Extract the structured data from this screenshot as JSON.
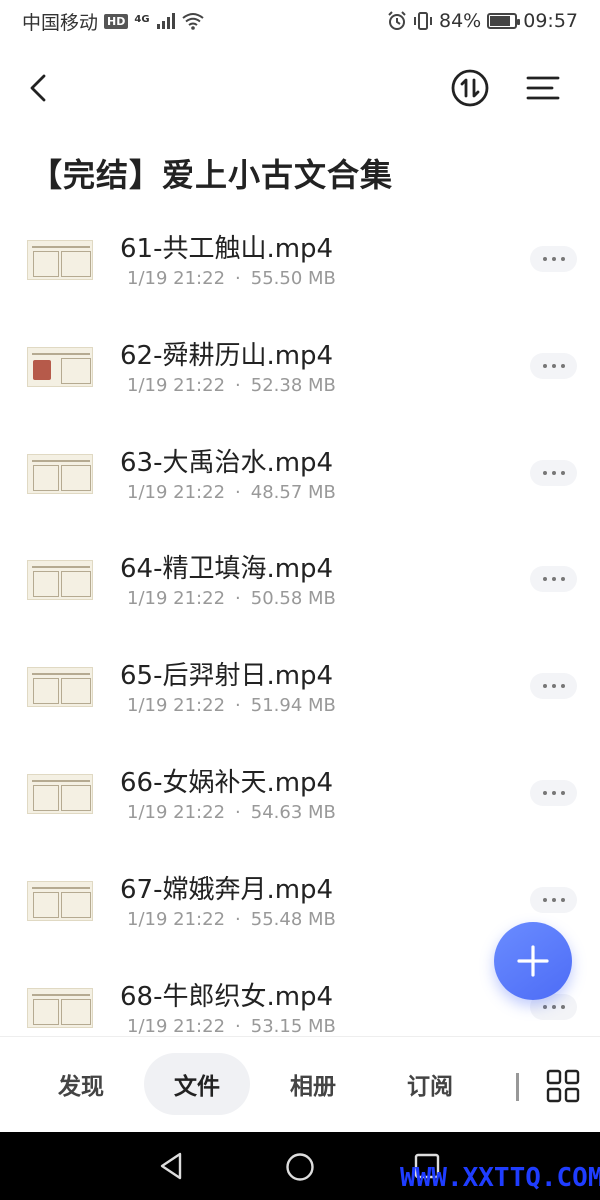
{
  "status_bar": {
    "carrier": "中国移动",
    "hd": "HD",
    "network": "4G",
    "battery_percent": "84%",
    "battery_level": 0.84,
    "time": "09:57"
  },
  "header": {
    "back_icon": "chevron-left-icon",
    "sort_icon": "sort-arrows-icon",
    "menu_icon": "menu-lines-icon"
  },
  "page_title": "【完结】爱上小古文合集",
  "files": [
    {
      "name": "61-共工触山.mp4",
      "date": "1/19 21:22",
      "separator": "·",
      "size": "55.50 MB"
    },
    {
      "name": "62-舜耕历山.mp4",
      "date": "1/19 21:22",
      "separator": "·",
      "size": "52.38 MB"
    },
    {
      "name": "63-大禹治水.mp4",
      "date": "1/19 21:22",
      "separator": "·",
      "size": "48.57 MB"
    },
    {
      "name": "64-精卫填海.mp4",
      "date": "1/19 21:22",
      "separator": "·",
      "size": "50.58 MB"
    },
    {
      "name": "65-后羿射日.mp4",
      "date": "1/19 21:22",
      "separator": "·",
      "size": "51.94 MB"
    },
    {
      "name": "66-女娲补天.mp4",
      "date": "1/19 21:22",
      "separator": "·",
      "size": "54.63 MB"
    },
    {
      "name": "67-嫦娥奔月.mp4",
      "date": "1/19 21:22",
      "separator": "·",
      "size": "55.48 MB"
    },
    {
      "name": "68-牛郎织女.mp4",
      "date": "1/19 21:22",
      "separator": "·",
      "size": "53.15 MB"
    }
  ],
  "bottom_nav": {
    "tabs": [
      {
        "label": "发现"
      },
      {
        "label": "文件"
      },
      {
        "label": "相册"
      },
      {
        "label": "订阅"
      }
    ],
    "active_tab": "文件"
  },
  "watermark": "WWW.XXTTQ.COM",
  "colors": {
    "accent": "#4d6cf6",
    "watermark": "#1f3dff"
  }
}
